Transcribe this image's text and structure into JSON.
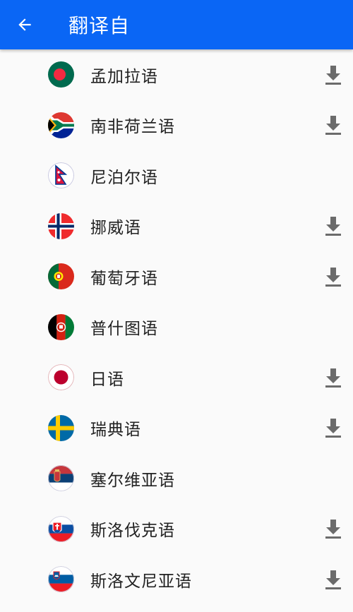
{
  "header": {
    "title": "翻译自",
    "back_icon": "arrow-left-icon",
    "background_color": "#0a66f5"
  },
  "languages": [
    {
      "label": "孟加拉语",
      "flag": "bangladesh-flag-icon",
      "download": true
    },
    {
      "label": "南非荷兰语",
      "flag": "south-africa-flag-icon",
      "download": true
    },
    {
      "label": "尼泊尔语",
      "flag": "nepal-flag-icon",
      "download": false
    },
    {
      "label": "挪威语",
      "flag": "norway-flag-icon",
      "download": true
    },
    {
      "label": "葡萄牙语",
      "flag": "portugal-flag-icon",
      "download": true
    },
    {
      "label": "普什图语",
      "flag": "afghanistan-flag-icon",
      "download": false
    },
    {
      "label": "日语",
      "flag": "japan-flag-icon",
      "download": true
    },
    {
      "label": "瑞典语",
      "flag": "sweden-flag-icon",
      "download": true
    },
    {
      "label": "塞尔维亚语",
      "flag": "serbia-flag-icon",
      "download": false
    },
    {
      "label": "斯洛伐克语",
      "flag": "slovakia-flag-icon",
      "download": true
    },
    {
      "label": "斯洛文尼亚语",
      "flag": "slovenia-flag-icon",
      "download": true
    }
  ],
  "download_icon": "download-icon"
}
